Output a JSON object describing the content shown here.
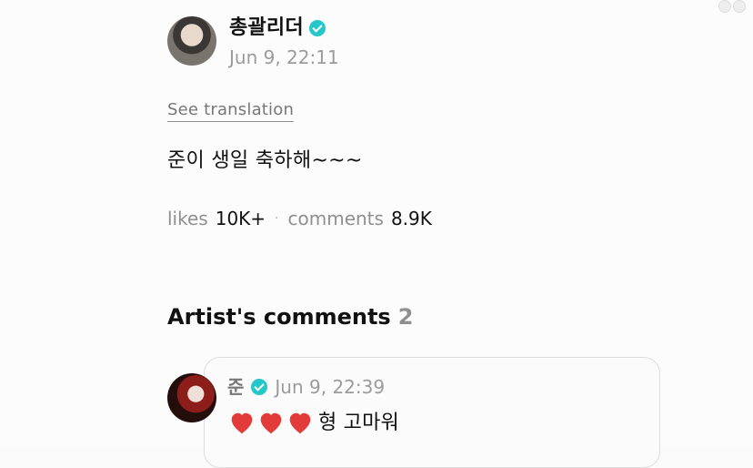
{
  "post": {
    "author_name": "총괄리더",
    "timestamp": "Jun 9, 22:11",
    "translation_label": "See translation",
    "body": "준이 생일 축하해~~~",
    "likes_label": "likes",
    "likes_value": "10K+",
    "comments_label": "comments",
    "comments_value": "8.9K"
  },
  "artist_comments": {
    "title": "Artist's comments",
    "count": "2",
    "items": [
      {
        "name": "준",
        "timestamp": "Jun 9, 22:39",
        "text": "형 고마워"
      }
    ]
  },
  "icons": {
    "verified": "verified-badge-icon",
    "heart": "heart-icon"
  },
  "colors": {
    "verified": "#25c7c8",
    "heart": "#e33a3a",
    "muted_text": "#9b9b9b"
  }
}
